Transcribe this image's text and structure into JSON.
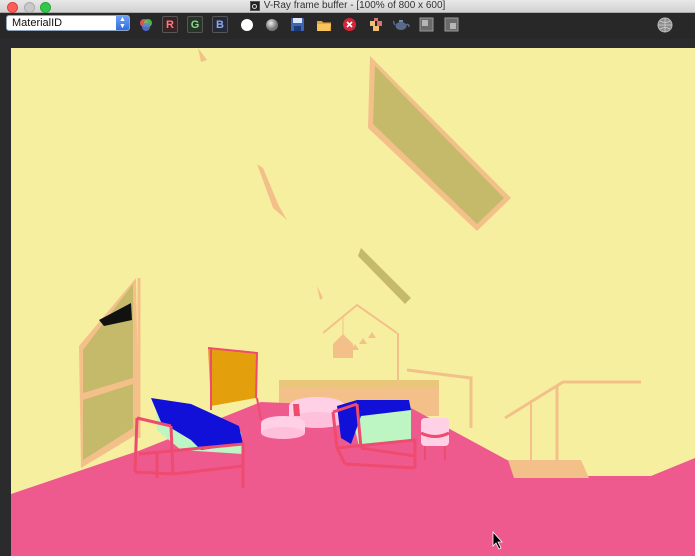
{
  "window": {
    "title": "V-Ray frame buffer - [100% of 800 x 600]"
  },
  "toolbar": {
    "channel_select": {
      "value": "MaterialID"
    },
    "r_label": "R",
    "g_label": "G",
    "b_label": "B",
    "icons": [
      "color-correction-icon",
      "white-circle-icon",
      "gray-circle-icon",
      "save-icon",
      "open-folder-icon",
      "clear-image-icon",
      "region-render-icon",
      "render-teapot-icon",
      "compare-a-icon",
      "compare-b-icon",
      "globe-icon"
    ]
  },
  "render": {
    "description_colors": {
      "wall": "#f6ef9f",
      "floor": "#ef5a8e",
      "chair_seat": "#1010d8",
      "cushion": "#bdf5c3",
      "frame": "#ee4b6f",
      "olive": "#c4ba6a",
      "peach": "#f4c08a",
      "orange": "#e3a00c"
    }
  }
}
